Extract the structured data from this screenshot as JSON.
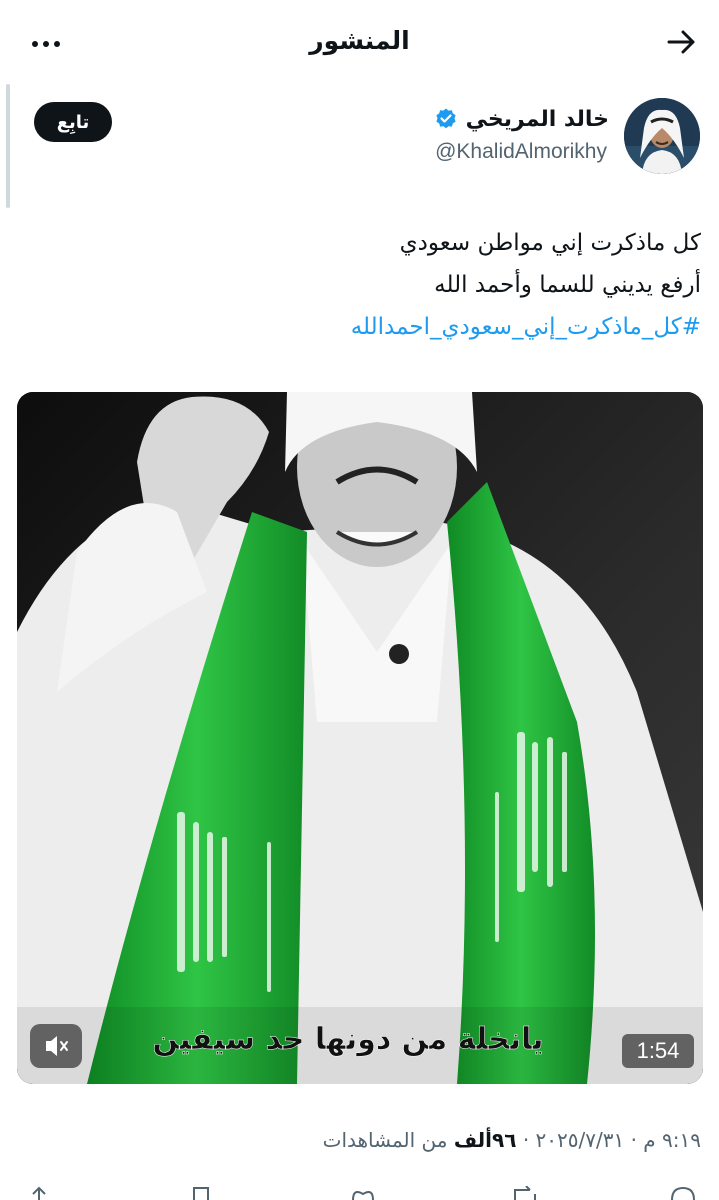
{
  "header": {
    "title": "المنشور",
    "back_icon": "arrow-right-icon",
    "more_icon": "more-dots-icon"
  },
  "author": {
    "name": "خالد المريخي",
    "handle": "@KhalidAlmorikhy",
    "verified": true,
    "verified_color": "#1d9bf0"
  },
  "follow_button": {
    "label": "تابِع"
  },
  "tweet": {
    "line1": "كل ماذكرت إني مواطن سعودي",
    "line2": "أرفع يديني للسما وأحمد الله",
    "hashtag": "#كل_ماذكرت_إني_سعودي_احمدالله"
  },
  "video": {
    "caption": "يانخلة من دونها حد سيفين",
    "duration": "1:54",
    "muted": true,
    "flag_color": "#1fa93a"
  },
  "meta": {
    "time": "٩:١٩ م",
    "date": "٢٠٢٥/٧/٣١",
    "separator": "·",
    "views_count": "٩٦ألف",
    "views_label": "من المشاهدات"
  },
  "colors": {
    "accent": "#1d9bf0",
    "text": "#0f1419",
    "secondary": "#536471"
  }
}
